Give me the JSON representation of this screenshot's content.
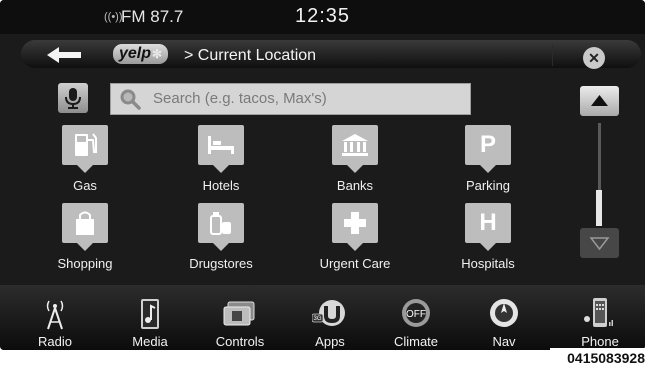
{
  "status": {
    "radio_station": "FM 87.7",
    "clock": "12:35"
  },
  "header": {
    "logo_text": "yelp",
    "breadcrumb": "> Current Location"
  },
  "search": {
    "placeholder": "Search (e.g. tacos, Max's)"
  },
  "categories": [
    {
      "label": "Gas",
      "icon": "fuel-pump-icon"
    },
    {
      "label": "Hotels",
      "icon": "bed-icon"
    },
    {
      "label": "Banks",
      "icon": "bank-icon"
    },
    {
      "label": "Parking",
      "icon": "parking-icon"
    },
    {
      "label": "Shopping",
      "icon": "shopping-bag-icon"
    },
    {
      "label": "Drugstores",
      "icon": "pill-bottles-icon"
    },
    {
      "label": "Urgent Care",
      "icon": "medical-cross-icon"
    },
    {
      "label": "Hospitals",
      "icon": "hospital-icon"
    }
  ],
  "nav": [
    {
      "label": "Radio",
      "icon": "radio-tower-icon"
    },
    {
      "label": "Media",
      "icon": "music-note-icon"
    },
    {
      "label": "Controls",
      "icon": "controls-icon"
    },
    {
      "label": "Apps",
      "icon": "apps-icon"
    },
    {
      "label": "Climate",
      "icon": "climate-icon"
    },
    {
      "label": "Nav",
      "icon": "compass-icon"
    },
    {
      "label": "Phone",
      "icon": "phone-icon"
    }
  ],
  "climate_badge": "OFF",
  "apps_badge": "3G",
  "figure_id": "0415083928"
}
